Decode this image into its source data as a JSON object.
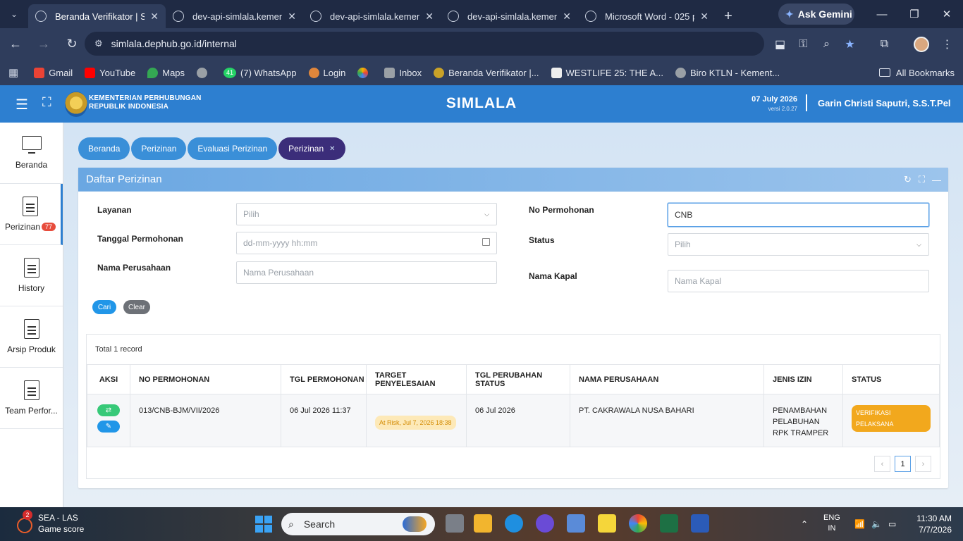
{
  "browser": {
    "tabs": [
      {
        "title": "Beranda Verifikator | Si",
        "active": true
      },
      {
        "title": "dev-api-simlala.kemenh",
        "active": false
      },
      {
        "title": "dev-api-simlala.kemenh",
        "active": false
      },
      {
        "title": "dev-api-simlala.kemenh",
        "active": false
      },
      {
        "title": "Microsoft Word - 025 p",
        "active": false
      }
    ],
    "gemini_label": "Ask Gemini",
    "url": "simlala.dephub.go.id/internal",
    "bookmarks": [
      {
        "label": "Gmail",
        "color": "#ea4335"
      },
      {
        "label": "YouTube",
        "color": "#ff0000"
      },
      {
        "label": "Maps",
        "color": "#34a853"
      },
      {
        "label": "",
        "color": "#9aa0a6"
      },
      {
        "label": "(7) WhatsApp",
        "color": "#25d366"
      },
      {
        "label": "Login",
        "color": "#e0863b"
      },
      {
        "label": "",
        "color": "#f4b400"
      },
      {
        "label": "Inbox",
        "color": "#9aa0a6"
      },
      {
        "label": "Beranda Verifikator |...",
        "color": "#c9a227"
      },
      {
        "label": "WESTLIFE 25: THE A...",
        "color": "#eeeeee"
      },
      {
        "label": "Biro KTLN - Kement...",
        "color": "#9aa0a6"
      }
    ],
    "whatsapp_count": "41",
    "all_bookmarks": "All Bookmarks"
  },
  "app": {
    "ministry_line1": "KEMENTERIAN PERHUBUNGAN",
    "ministry_line2": "REPUBLIK INDONESIA",
    "title": "SIMLALA",
    "date": "07 July 2026",
    "version": "versi 2.0.27",
    "user": "Garin Christi Saputri, S.S.T.Pel",
    "accent": "#2d7fd0"
  },
  "sidebar": {
    "items": [
      {
        "label": "Beranda",
        "icon": "monitor-icon"
      },
      {
        "label": "Perizinan",
        "icon": "document-icon",
        "badge": "77"
      },
      {
        "label": "History",
        "icon": "document-icon"
      },
      {
        "label": "Arsip Produk",
        "icon": "document-icon"
      },
      {
        "label": "Team Perfor...",
        "icon": "document-icon"
      }
    ]
  },
  "breadcrumbs": [
    {
      "label": "Beranda"
    },
    {
      "label": "Perizinan"
    },
    {
      "label": "Evaluasi Perizinan"
    },
    {
      "label": "Perizinan"
    }
  ],
  "panel": {
    "title": "Daftar Perizinan"
  },
  "filters": {
    "layanan_label": "Layanan",
    "layanan_placeholder": "Pilih",
    "tanggal_label": "Tanggal Permohonan",
    "tanggal_placeholder": "dd-mm-yyyy hh:mm",
    "nama_perusahaan_label": "Nama Perusahaan",
    "nama_perusahaan_placeholder": "Nama Perusahaan",
    "no_permohonan_label": "No Permohonan",
    "no_permohonan_value": "CNB",
    "status_label": "Status",
    "status_placeholder": "Pilih",
    "nama_kapal_label": "Nama Kapal",
    "nama_kapal_placeholder": "Nama Kapal",
    "cari_label": "Cari",
    "clear_label": "Clear"
  },
  "table": {
    "total": "Total 1 record",
    "headers": [
      "AKSI",
      "NO PERMOHONAN",
      "TGL PERMOHONAN",
      "TARGET PENYELESAIAN",
      "TGL PERUBAHAN STATUS",
      "NAMA PERUSAHAAN",
      "JENIS IZIN",
      "STATUS"
    ],
    "rows": [
      {
        "no_permohonan": "013/CNB-BJM/VII/2026",
        "tgl_permohonan": "06 Jul 2026 11:37",
        "target": "At Risk, Jul 7, 2026 18:38",
        "tgl_perubahan": "06 Jul 2026",
        "nama_perusahaan": "PT. CAKRAWALA NUSA BAHARI",
        "jenis_izin": "PENAMBAHAN PELABUHAN RPK TRAMPER",
        "status": "VERIFIKASI PELAKSANA"
      }
    ],
    "page": "1"
  },
  "taskbar": {
    "weather_title": "SEA - LAS",
    "weather_sub": "Game score",
    "weather_badge": "2",
    "search_placeholder": "Search",
    "lang_top": "ENG",
    "lang_bottom": "IN",
    "time": "11:30 AM",
    "date": "7/7/2026"
  }
}
